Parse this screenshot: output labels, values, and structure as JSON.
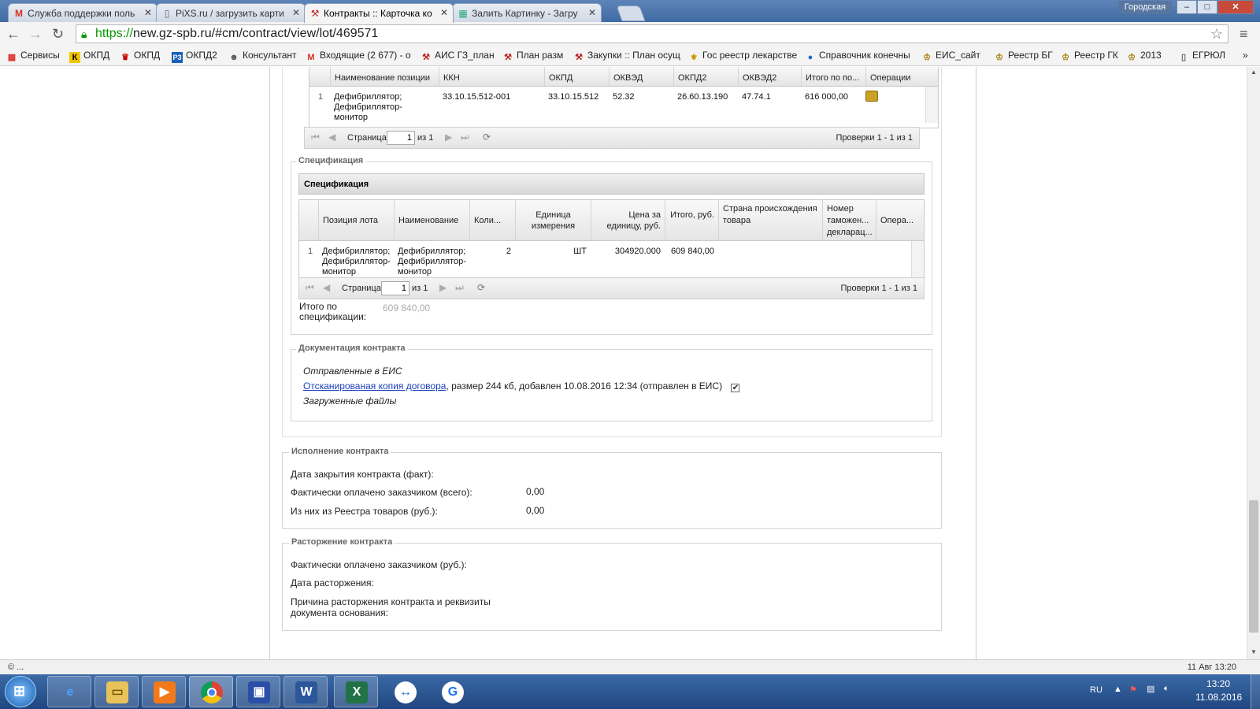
{
  "browser": {
    "tabs": [
      {
        "label": "Служба поддержки поль",
        "icon": "gmail-icon"
      },
      {
        "label": "PiXS.ru / загрузить карти",
        "icon": "page-icon"
      },
      {
        "label": "Контракты :: Карточка ко",
        "icon": "gz-icon"
      },
      {
        "label": "Залить Картинку - Загру",
        "icon": "image-icon"
      }
    ],
    "window_label": "Городская",
    "window_buttons": {
      "minimize": "–",
      "maximize": "□",
      "close": "✕"
    },
    "url_https": "https://",
    "url_rest": "new.gz-spb.ru/#cm/contract/view/lot/469571",
    "bookmarks": [
      {
        "label": "Сервисы",
        "icon": "apps-icon"
      },
      {
        "label": "ОКПД",
        "icon": "k-icon"
      },
      {
        "label": "ОКПД",
        "icon": "emblem-icon"
      },
      {
        "label": "ОКПД2",
        "icon": "p3-icon"
      },
      {
        "label": "Консультант",
        "icon": "consultant-icon"
      },
      {
        "label": "Входящие (2 677) - о",
        "icon": "gmail-icon"
      },
      {
        "label": "АИС ГЗ_план",
        "icon": "gz-icon"
      },
      {
        "label": "План разм",
        "icon": "gz-icon"
      },
      {
        "label": "Закупки :: План осущ",
        "icon": "gz-icon"
      },
      {
        "label": "Гос реестр лекарстве",
        "icon": "registry-icon"
      },
      {
        "label": "Справочник конечны",
        "icon": "globe-icon"
      },
      {
        "label": "ЕИС_сайт",
        "icon": "eagle-icon"
      },
      {
        "label": "Реестр БГ",
        "icon": "eagle-icon"
      },
      {
        "label": "Реестр ГК",
        "icon": "eagle-icon"
      },
      {
        "label": "2013",
        "icon": "eagle-icon"
      },
      {
        "label": "ЕГРЮЛ",
        "icon": "page-icon"
      }
    ],
    "bookmarks_more": "»"
  },
  "lot_positions": {
    "columns": [
      "Наименование позиции",
      "ККН",
      "ОКПД",
      "ОКВЭД",
      "ОКПД2",
      "ОКВЭД2",
      "Итого по по...",
      "Операции"
    ],
    "rows": [
      {
        "num": "1",
        "name": "Дефибриллятор; Дефибриллятор-монитор",
        "kkn": "33.10.15.512-001",
        "okpd": "33.10.15.512",
        "okved": "52.32",
        "okpd2": "26.60.13.190",
        "okved2": "47.74.1",
        "total": "616 000,00"
      }
    ],
    "pager": {
      "page_label": "Страница",
      "page": "1",
      "of": "из 1",
      "summary": "Проверки 1 - 1 из 1"
    }
  },
  "specification": {
    "legend": "Спецификация",
    "title": "Спецификация",
    "columns": [
      "Позиция лота",
      "Наименование",
      "Коли...",
      "Единица измерения",
      "Цена за единицу, руб.",
      "Итого, руб.",
      "Страна происхождения товара",
      "Номер таможен... декларац...",
      "Опера..."
    ],
    "rows": [
      {
        "num": "1",
        "position": "Дефибриллятор; Дефибриллятор-монитор",
        "name": "Дефибриллятор; Дефибриллятор-монитор",
        "qty": "2",
        "unit": "ШТ",
        "price": "304920.000",
        "total": "609 840,00"
      }
    ],
    "pager": {
      "page_label": "Страница",
      "page": "1",
      "of": "из 1",
      "summary": "Проверки 1 - 1 из 1"
    },
    "total_label": "Итого по спецификации:",
    "total_value": "609 840,00"
  },
  "documentation": {
    "legend": "Документация контракта",
    "sent_label": "Отправленные в ЕИС",
    "file_link": "Отсканированая копия договора",
    "file_meta": ", размер 244 кб, добавлен 10.08.2016 12:34 (отправлен в ЕИС)",
    "file_checked": true,
    "uploaded_label": "Загруженные файлы"
  },
  "execution": {
    "legend": "Исполнение контракта",
    "close_date_label": "Дата закрытия контракта (факт):",
    "paid_total_label": "Фактически оплачено заказчиком (всего):",
    "paid_total_value": "0,00",
    "registry_label": "Из них из Реестра товаров (руб.):",
    "registry_value": "0,00"
  },
  "termination": {
    "legend": "Расторжение контракта",
    "paid_label": "Фактически оплачено заказчиком (руб.):",
    "date_label": "Дата расторжения:",
    "reason_label": "Причина расторжения контракта и реквизиты документа основания:"
  },
  "statusbar": {
    "left": "© ...",
    "right": "11 Авг 13:20"
  },
  "taskbar": {
    "lang": "RU",
    "time": "13:20",
    "date": "11.08.2016",
    "apps": [
      {
        "icon": "ie-icon"
      },
      {
        "icon": "explorer-icon"
      },
      {
        "icon": "media-player-icon"
      },
      {
        "icon": "chrome-icon"
      },
      {
        "icon": "save-app-icon"
      },
      {
        "icon": "word-icon"
      },
      {
        "icon": "excel-icon"
      },
      {
        "icon": "teamviewer-icon"
      },
      {
        "icon": "g-app-icon"
      }
    ]
  },
  "colors": {
    "accent_link": "#1a3fbf",
    "https_green": "#079500",
    "taskbar": "#2a5591"
  }
}
